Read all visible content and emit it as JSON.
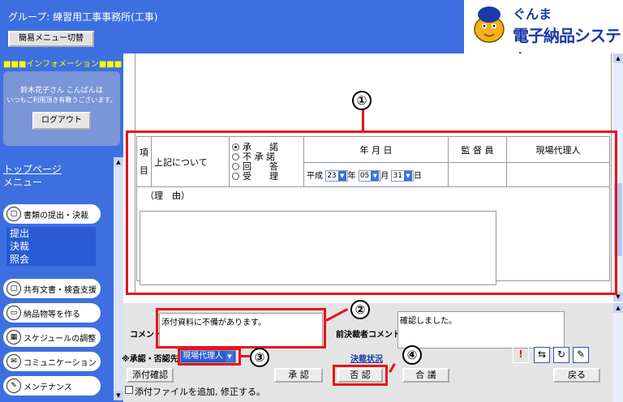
{
  "header": {
    "group_text": "グループ: 練習用工事事務所(工事)",
    "simple_menu_label": "簡易メニュー切替",
    "logo_line1": "ぐんま",
    "logo_line2": "電子納品システム"
  },
  "sidebar": {
    "info_title": "■■■インフォメーション■■■",
    "user_greeting": "鈴木花子さん こんばんは",
    "user_message": "いつもご利用頂き有難うございます。",
    "logout_label": "ログアウト",
    "top_page_link": "トップページ",
    "menu_label": "メニュー",
    "nav": [
      {
        "label": "書類の提出・決裁",
        "icon": "document-icon"
      },
      {
        "label": "共有文書・検査支援",
        "icon": "document-icon"
      },
      {
        "label": "納品物等を作る",
        "icon": "box-icon"
      },
      {
        "label": "スケジュールの調整",
        "icon": "calendar-icon"
      },
      {
        "label": "コミュニケーション",
        "icon": "mail-icon"
      },
      {
        "label": "メンテナンス",
        "icon": "wrench-icon"
      }
    ],
    "sub_items": [
      "提出",
      "決裁",
      "照会"
    ]
  },
  "form": {
    "item_label": "項目",
    "about_label": "上記について",
    "radio_options": [
      "承　　諾",
      "不 承 諾",
      "回　　答",
      "受　　理"
    ],
    "selected_radio": 0,
    "date_header": "年 月 日",
    "supervisor_header": "監 督 員",
    "agent_header": "現場代理人",
    "era": "平成",
    "year_value": "23",
    "year_unit": "年",
    "month_value": "05",
    "month_unit": "月",
    "day_value": "31",
    "day_unit": "日",
    "reason_label": "（理　由）"
  },
  "annotations": {
    "n1": "①",
    "n2": "②",
    "n3": "③",
    "n4": "④"
  },
  "bottom": {
    "comment_label": "コメント",
    "comment_value": "添付資料に不備があります。",
    "prev_comment_label": "前決裁者コメント",
    "prev_comment_value": "確認しました。",
    "approver_label": "※承認・否認先",
    "approver_value": "現場代理人",
    "status_link": "決裁状況",
    "attach_confirm": "添付確認",
    "approve": "承 認",
    "reject": "否 認",
    "consult": "合 議",
    "back": "戻る",
    "attach_check_label": "添付ファイルを追加, 修正する。"
  },
  "colors": {
    "brand_blue": "#3d6fe0",
    "annotation_red": "#e8131a"
  }
}
